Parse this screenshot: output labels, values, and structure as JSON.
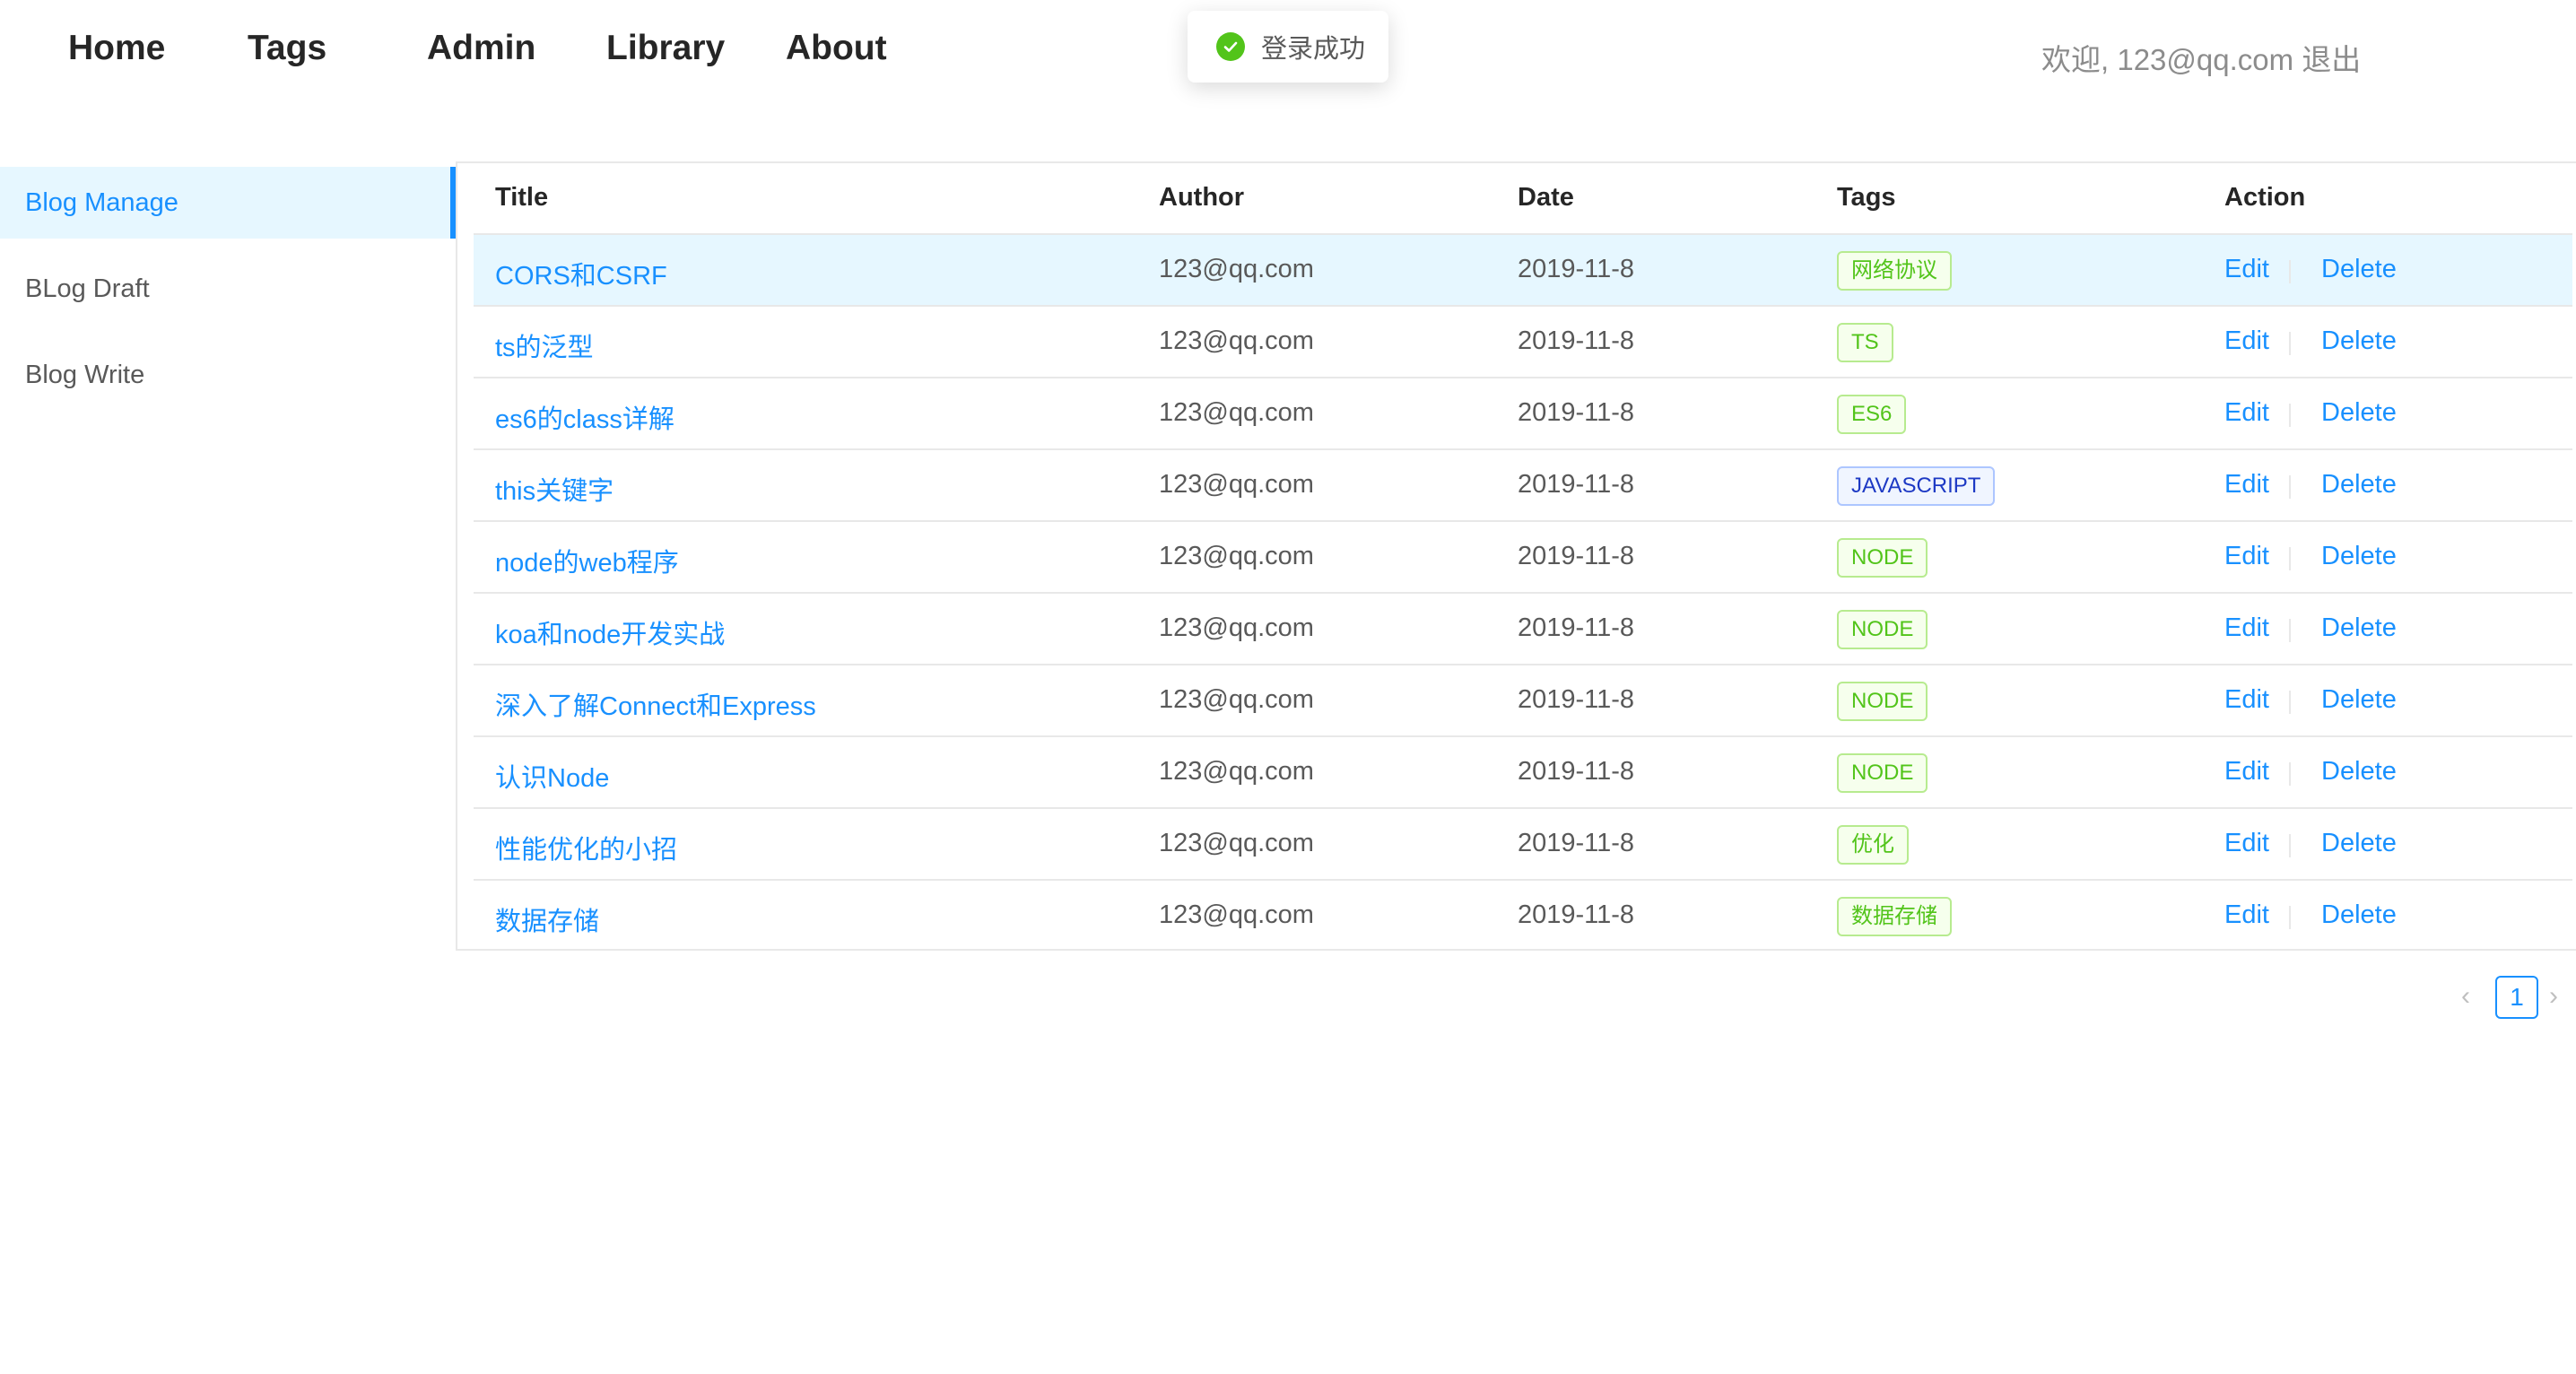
{
  "nav": {
    "home": "Home",
    "tags": "Tags",
    "admin": "Admin",
    "library": "Library",
    "about": "About"
  },
  "user": {
    "welcome": "欢迎, 123@qq.com",
    "logout": "退出"
  },
  "toast": {
    "icon": "check-circle-icon",
    "text": "登录成功",
    "color": "#52c41a"
  },
  "sidebar": {
    "items": [
      {
        "label": "Blog Manage",
        "active": true
      },
      {
        "label": "BLog Draft",
        "active": false
      },
      {
        "label": "Blog Write",
        "active": false
      }
    ]
  },
  "table": {
    "columns": [
      "Title",
      "Author",
      "Date",
      "Tags",
      "Action"
    ],
    "rows": [
      {
        "title": "CORS和CSRF",
        "author": "123@qq.com",
        "date": "2019-11-8",
        "tag": "网络协议",
        "tag_color": "green"
      },
      {
        "title": "ts的泛型",
        "author": "123@qq.com",
        "date": "2019-11-8",
        "tag": "TS",
        "tag_color": "green"
      },
      {
        "title": "es6的class详解",
        "author": "123@qq.com",
        "date": "2019-11-8",
        "tag": "ES6",
        "tag_color": "green"
      },
      {
        "title": "this关键字",
        "author": "123@qq.com",
        "date": "2019-11-8",
        "tag": "JAVASCRIPT",
        "tag_color": "blue"
      },
      {
        "title": "node的web程序",
        "author": "123@qq.com",
        "date": "2019-11-8",
        "tag": "NODE",
        "tag_color": "green"
      },
      {
        "title": "koa和node开发实战",
        "author": "123@qq.com",
        "date": "2019-11-8",
        "tag": "NODE",
        "tag_color": "green"
      },
      {
        "title": "深入了解Connect和Express",
        "author": "123@qq.com",
        "date": "2019-11-8",
        "tag": "NODE",
        "tag_color": "green"
      },
      {
        "title": "认识Node",
        "author": "123@qq.com",
        "date": "2019-11-8",
        "tag": "NODE",
        "tag_color": "green"
      },
      {
        "title": "性能优化的小招",
        "author": "123@qq.com",
        "date": "2019-11-8",
        "tag": "优化",
        "tag_color": "green"
      },
      {
        "title": "数据存储",
        "author": "123@qq.com",
        "date": "2019-11-8",
        "tag": "数据存储",
        "tag_color": "green"
      }
    ],
    "edit_label": "Edit",
    "delete_label": "Delete"
  },
  "pagination": {
    "current": "1",
    "prev_icon": "chevron-left-icon",
    "next_icon": "chevron-right-icon"
  },
  "colors": {
    "primary": "#1890ff",
    "highlight_row": "#e6f7ff",
    "tag_green": "#52c41a",
    "tag_blue": "#1d39c4"
  }
}
